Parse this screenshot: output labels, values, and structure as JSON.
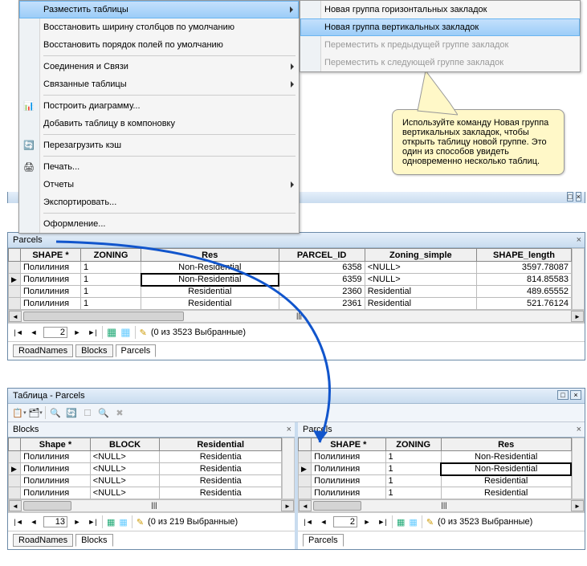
{
  "menu1": {
    "items": [
      {
        "label": "Разместить таблицы",
        "arrow": true,
        "hl": true
      },
      {
        "label": "Восстановить ширину столбцов по умолчанию"
      },
      {
        "label": "Восстановить порядок полей по умолчанию"
      },
      {
        "sep": true
      },
      {
        "label": "Соединения и Связи",
        "arrow": true
      },
      {
        "label": "Связанные таблицы",
        "arrow": true
      },
      {
        "sep": true
      },
      {
        "label": "Построить диаграмму...",
        "icon": "chart"
      },
      {
        "label": "Добавить таблицу в компоновку"
      },
      {
        "sep": true
      },
      {
        "label": "Перезагрузить кэш",
        "icon": "refresh"
      },
      {
        "sep": true
      },
      {
        "label": "Печать...",
        "icon": "print"
      },
      {
        "label": "Отчеты",
        "arrow": true
      },
      {
        "label": "Экспортировать..."
      },
      {
        "sep": true
      },
      {
        "label": "Оформление..."
      }
    ]
  },
  "menu2": {
    "items": [
      {
        "label": "Новая группа горизонтальных закладок"
      },
      {
        "label": "Новая группа вертикальных закладок",
        "hl": true
      },
      {
        "label": "Переместить к предыдущей группе закладок",
        "disabled": true
      },
      {
        "label": "Переместить к следующей группе закладок",
        "disabled": true
      }
    ]
  },
  "callout": {
    "text": "Используйте команду Новая группа вертикальных закладок, чтобы открыть таблицу новой группе.  Это один из способов увидеть одновременно несколько таблиц."
  },
  "topPanel": {
    "title": "Parcels",
    "cols": [
      "SHAPE *",
      "ZONING",
      "Res",
      "PARCEL_ID",
      "Zoning_simple",
      "SHAPE_length"
    ],
    "rows": [
      {
        "shape": "Полилиния",
        "zoning": "1",
        "res": "Non-Residential",
        "pid": "6358",
        "zs": "<NULL>",
        "len": "3597.78087"
      },
      {
        "shape": "Полилиния",
        "zoning": "1",
        "res": "Non-Residential",
        "pid": "6359",
        "zs": "<NULL>",
        "len": "814.85583",
        "marker": true,
        "sel": true
      },
      {
        "shape": "Полилиния",
        "zoning": "1",
        "res": "Residential",
        "pid": "2360",
        "zs": "Residential",
        "len": "489.65552"
      },
      {
        "shape": "Полилиния",
        "zoning": "1",
        "res": "Residential",
        "pid": "2361",
        "zs": "Residential",
        "len": "521.76124"
      }
    ],
    "nav": {
      "pos": "2",
      "status": "(0 из 3523 Выбранные)"
    },
    "tabs": [
      "RoadNames",
      "Blocks",
      "Parcels"
    ],
    "activeTab": 2
  },
  "lowerTitle": "Таблица - Parcels",
  "blocksPanel": {
    "title": "Blocks",
    "cols": [
      "Shape *",
      "BLOCK",
      "Residential"
    ],
    "rows": [
      {
        "shape": "Полилиния",
        "block": "<NULL>",
        "res": "Residentia"
      },
      {
        "shape": "Полилиния",
        "block": "<NULL>",
        "res": "Residentia",
        "marker": true
      },
      {
        "shape": "Полилиния",
        "block": "<NULL>",
        "res": "Residentia"
      },
      {
        "shape": "Полилиния",
        "block": "<NULL>",
        "res": "Residentia"
      }
    ],
    "nav": {
      "pos": "13",
      "status": "(0 из 219 Выбранные)"
    },
    "tabs": [
      "RoadNames",
      "Blocks"
    ],
    "activeTab": 1
  },
  "parcelsPanel": {
    "title": "Parcels",
    "cols": [
      "SHAPE *",
      "ZONING",
      "Res"
    ],
    "rows": [
      {
        "shape": "Полилиния",
        "zoning": "1",
        "res": "Non-Residential"
      },
      {
        "shape": "Полилиния",
        "zoning": "1",
        "res": "Non-Residential",
        "marker": true,
        "sel": true
      },
      {
        "shape": "Полилиния",
        "zoning": "1",
        "res": "Residential"
      },
      {
        "shape": "Полилиния",
        "zoning": "1",
        "res": "Residential"
      }
    ],
    "nav": {
      "pos": "2",
      "status": "(0 из 3523 Выбранные)"
    },
    "tabs": [
      "Parcels"
    ],
    "activeTab": 0
  }
}
